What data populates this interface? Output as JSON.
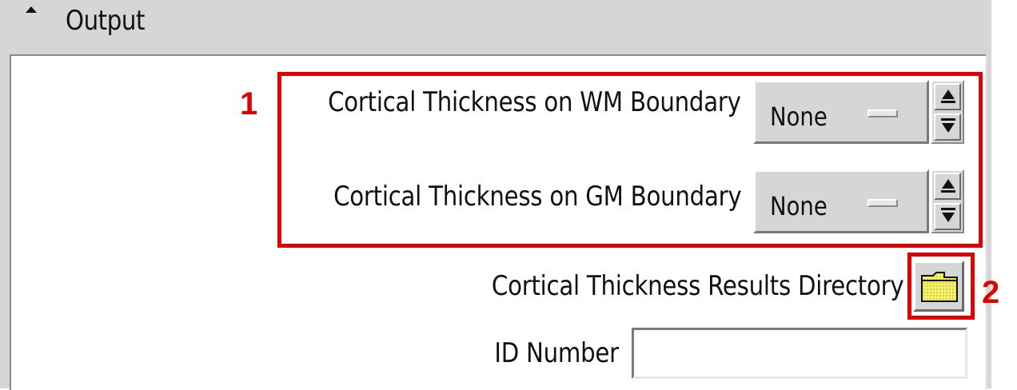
{
  "section": {
    "title": "Output",
    "toggle_icon": "collapse-triangle-icon"
  },
  "fields": {
    "wm_boundary": {
      "label": "Cortical Thickness on WM Boundary",
      "value": "None"
    },
    "gm_boundary": {
      "label": "Cortical Thickness on GM Boundary",
      "value": "None"
    },
    "results_dir": {
      "label": "Cortical Thickness Results Directory",
      "icon": "folder-icon"
    },
    "id_number": {
      "label": "ID Number",
      "value": ""
    }
  },
  "annotations": {
    "callout_1": "1",
    "callout_2": "2",
    "highlight_color": "#e00000"
  }
}
